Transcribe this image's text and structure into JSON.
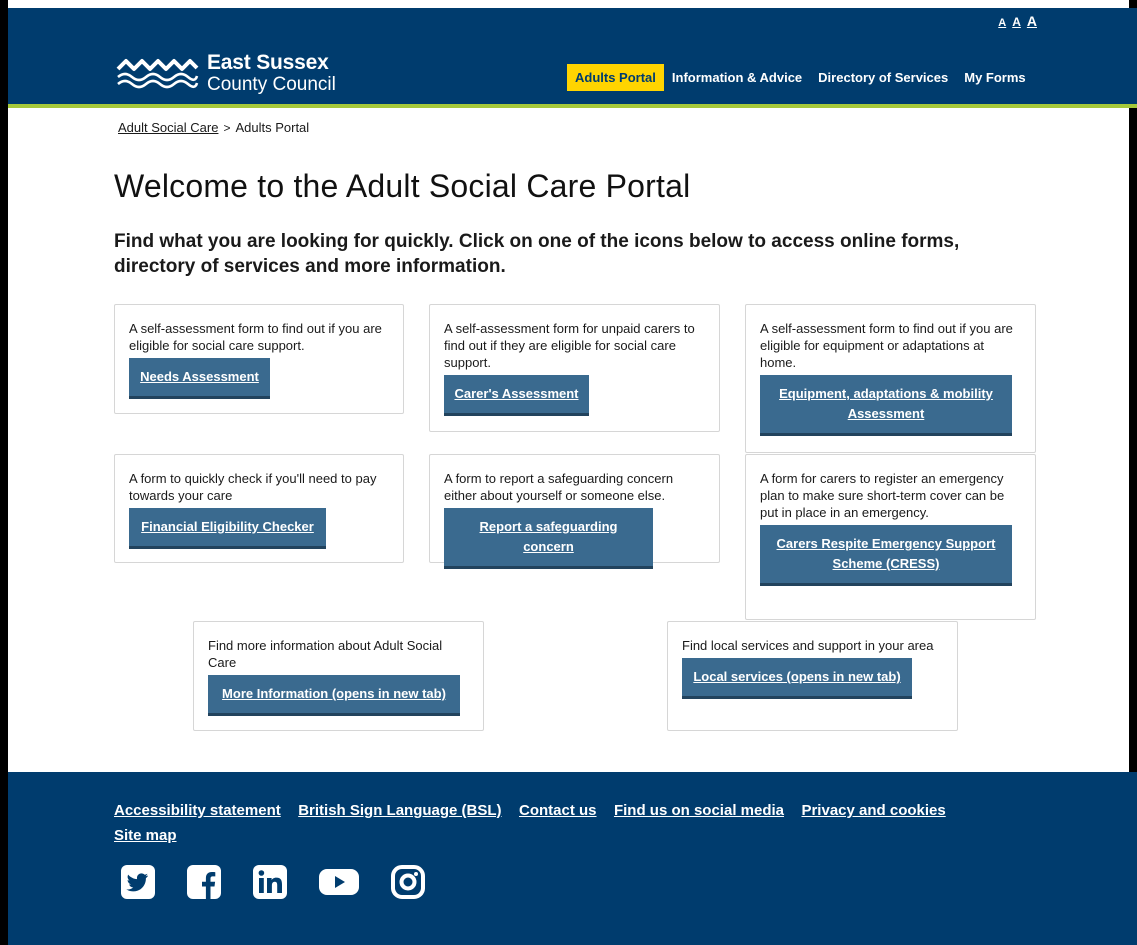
{
  "text_size": {
    "small": "A",
    "medium": "A",
    "large": "A"
  },
  "logo": {
    "line1": "East Sussex",
    "line2": "County Council"
  },
  "nav": [
    {
      "label": "Adults Portal",
      "active": true
    },
    {
      "label": "Information & Advice"
    },
    {
      "label": "Directory of Services"
    },
    {
      "label": "My Forms"
    }
  ],
  "breadcrumb": {
    "parent": "Adult Social Care",
    "separator": ">",
    "current": "Adults Portal"
  },
  "page_title": "Welcome to the Adult Social Care Portal",
  "intro": "Find what you are looking for quickly. Click on one of the icons below to access online forms, directory of services and more information.",
  "cards": [
    {
      "desc": "A self-assessment form to find out if you are eligible for social care support.",
      "button": "Needs Assessment"
    },
    {
      "desc": "A self-assessment form for unpaid carers to find out if they are eligible for social care support.",
      "button": "Carer's Assessment"
    },
    {
      "desc": "A self-assessment form to find out if you are eligible for equipment or adaptations at home.",
      "button": "Equipment, adaptations & mobility Assessment"
    },
    {
      "desc": "A form to quickly check if you'll need to pay towards your care",
      "button": "Financial Eligibility Checker"
    },
    {
      "desc": "A form to report a safeguarding concern either about yourself or someone else.",
      "button": "Report a safeguarding concern"
    },
    {
      "desc": "A form for carers to register an emergency plan to make sure short-term cover can be put in place in an emergency.",
      "button": "Carers Respite Emergency Support Scheme (CRESS)"
    },
    {
      "desc": "Find more information about Adult Social Care",
      "button": "More Information (opens in new tab)"
    },
    {
      "desc": "Find local services and support in your area",
      "button": "Local services (opens in new tab)"
    }
  ],
  "footer": {
    "links": [
      "Accessibility statement",
      "British Sign Language (BSL)",
      "Contact us",
      "Find us on social media",
      "Privacy and cookies",
      "Site map"
    ],
    "social": [
      "twitter-icon",
      "facebook-icon",
      "linkedin-icon",
      "youtube-icon",
      "instagram-icon"
    ]
  },
  "colors": {
    "header_bg": "#003c6e",
    "accent_yellow": "#ffd400",
    "accent_green": "#a6c83a",
    "button_bg": "#3a6a8f"
  }
}
